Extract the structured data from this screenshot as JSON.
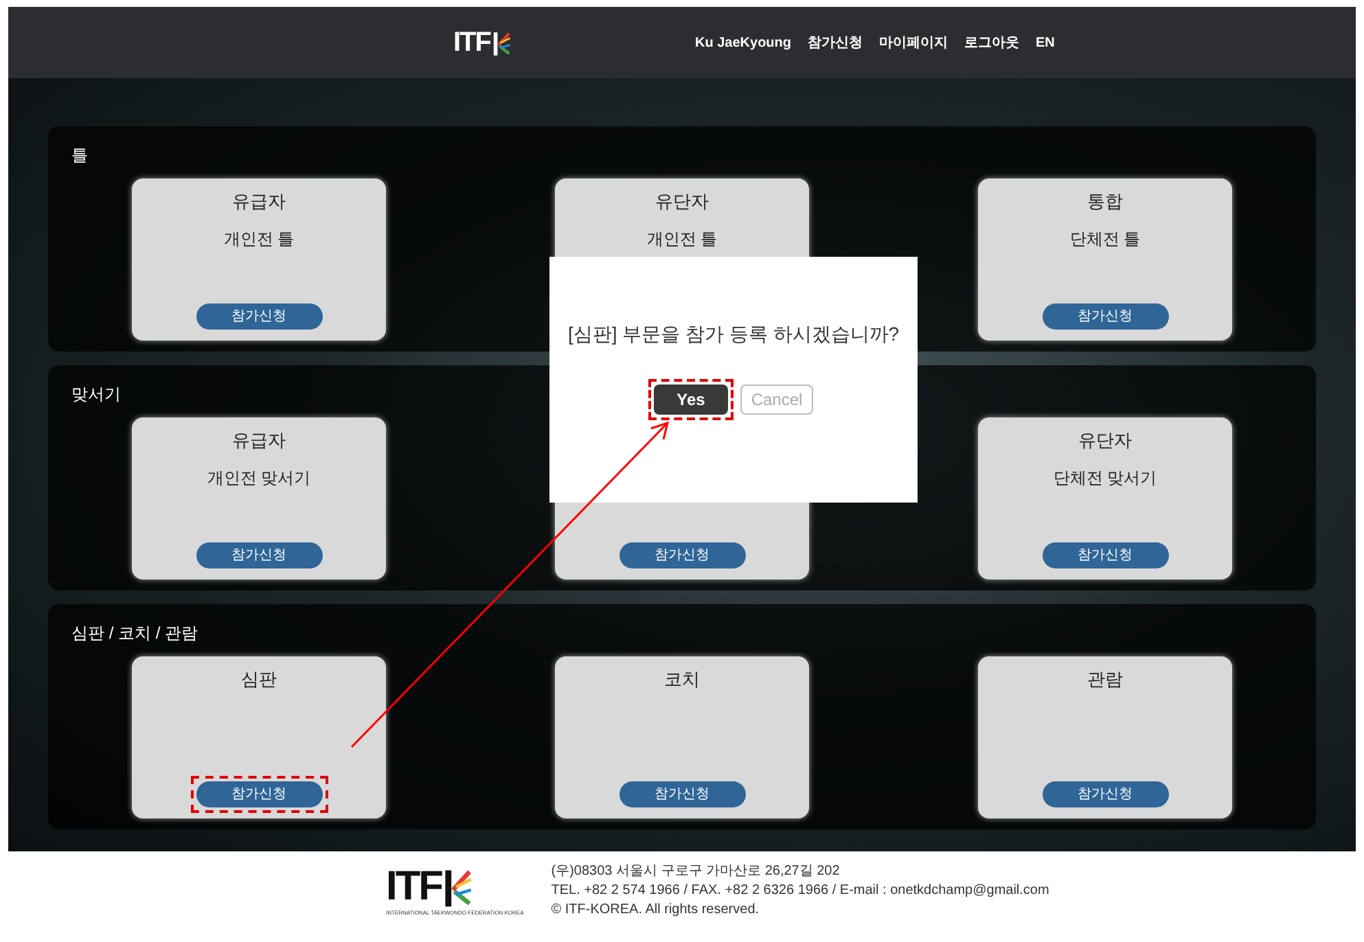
{
  "header": {
    "logo": "ITF",
    "nav": [
      {
        "label": "Ku JaeKyoung"
      },
      {
        "label": "참가신청"
      },
      {
        "label": "마이페이지"
      },
      {
        "label": "로그아웃"
      },
      {
        "label": "EN"
      }
    ]
  },
  "sections": [
    {
      "title": "틀",
      "cards": [
        {
          "title": "유급자",
          "subtitle": "개인전 틀",
          "button": {
            "label": "참가신청",
            "highlighted": false
          }
        },
        {
          "title": "유단자",
          "subtitle": "개인전 틀"
        },
        {
          "title": "통합",
          "subtitle": "단체전 틀",
          "button": {
            "label": "참가신청",
            "highlighted": false
          }
        }
      ]
    },
    {
      "title": "맞서기",
      "cards": [
        {
          "title": "유급자",
          "subtitle": "개인전 맞서기",
          "button": {
            "label": "참가신청",
            "highlighted": false
          }
        },
        {
          "button": {
            "label": "참가신청",
            "highlighted": false
          }
        },
        {
          "title": "유단자",
          "subtitle": "단체전 맞서기",
          "button": {
            "label": "참가신청",
            "highlighted": false
          }
        }
      ]
    },
    {
      "title": "심판 / 코치 / 관람",
      "cards": [
        {
          "title": "심판",
          "button": {
            "label": "참가신청",
            "highlighted": true
          }
        },
        {
          "title": "코치",
          "button": {
            "label": "참가신청",
            "highlighted": false
          }
        },
        {
          "title": "관람",
          "button": {
            "label": "참가신청",
            "highlighted": false
          }
        }
      ]
    }
  ],
  "dialog": {
    "message": "[심판] 부문을 참가 등록 하시겠습니까?",
    "buttons": [
      {
        "label": "Yes",
        "kind": "primary",
        "highlighted": true
      },
      {
        "label": "Cancel",
        "kind": "secondary",
        "highlighted": false
      }
    ]
  },
  "footer": {
    "logo": "ITF",
    "logo_caption": "INTERNATIONAL TAEKWONDO FEDERATION KOREA",
    "lines": [
      "(우)08303 서울시 구로구 가마산로 26,27길 202",
      "TEL. +82 2 574 1966 / FAX. +82 2 6326 1966 / E-mail : onetkdchamp@gmail.com",
      "© ITF-KOREA. All rights reserved."
    ]
  }
}
